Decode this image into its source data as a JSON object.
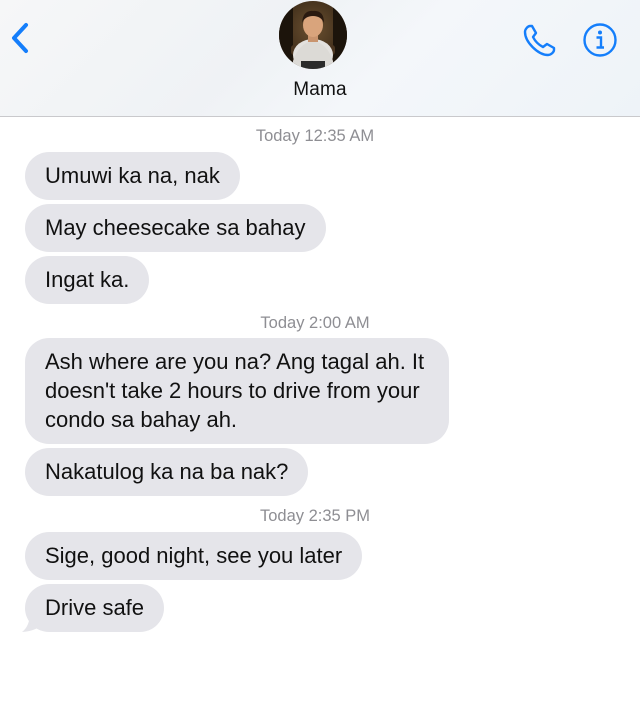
{
  "header": {
    "contact_name": "Mama"
  },
  "colors": {
    "accent": "#147efb",
    "received_bubble": "#e5e5ea",
    "timestamp": "#8e8e93"
  },
  "icons": {
    "back": "chevron-left-icon",
    "phone": "phone-icon",
    "info": "info-icon"
  },
  "thread": {
    "groups": [
      {
        "timestamp": "Today 12:35 AM",
        "messages": [
          "Umuwi ka na, nak",
          "May cheesecake sa bahay",
          "Ingat ka."
        ]
      },
      {
        "timestamp": "Today 2:00 AM",
        "messages": [
          "Ash where are you na? Ang tagal ah. It doesn't take 2 hours to drive from your condo sa bahay ah.",
          "Nakatulog ka na ba nak?"
        ]
      },
      {
        "timestamp": "Today 2:35 PM",
        "messages": [
          "Sige, good night, see you later",
          "Drive safe"
        ]
      }
    ]
  }
}
